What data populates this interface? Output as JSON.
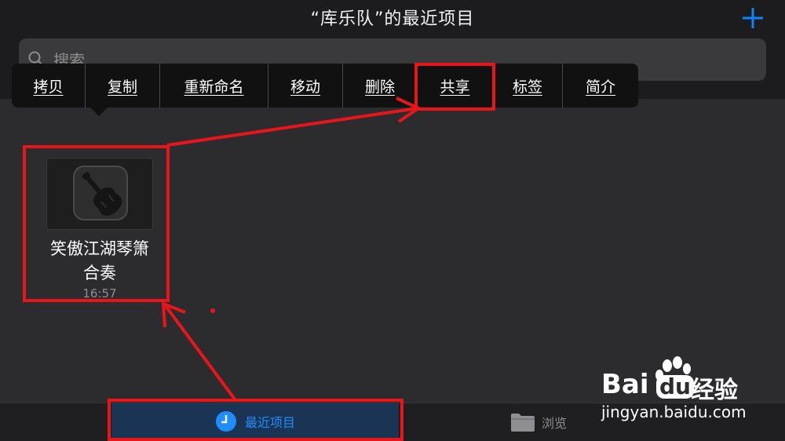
{
  "header": {
    "title": "“库乐队”的最近项目",
    "add_icon": "plus-icon",
    "accent_color": "#0a84ff"
  },
  "search": {
    "placeholder": "搜索",
    "icon": "search-icon"
  },
  "context_menu": {
    "items": [
      "拷贝",
      "复制",
      "重新命名",
      "移动",
      "删除",
      "共享",
      "标签",
      "简介"
    ]
  },
  "project": {
    "name_line1": "笑傲江湖琴箫",
    "name_line2": "合奏",
    "time": "16:57",
    "icon": "garageband-guitar-icon"
  },
  "tabbar": {
    "recent_label": "最近项目",
    "recent_icon": "clock-icon",
    "browse_label": "浏览",
    "browse_icon": "folder-icon",
    "active_color": "#1f8cff"
  },
  "annotations": {
    "color": "#e8161b"
  },
  "watermark": {
    "brand_a": "Bai",
    "brand_b": "du",
    "brand_cn": "经验",
    "url": "jingyan.baidu.com"
  }
}
